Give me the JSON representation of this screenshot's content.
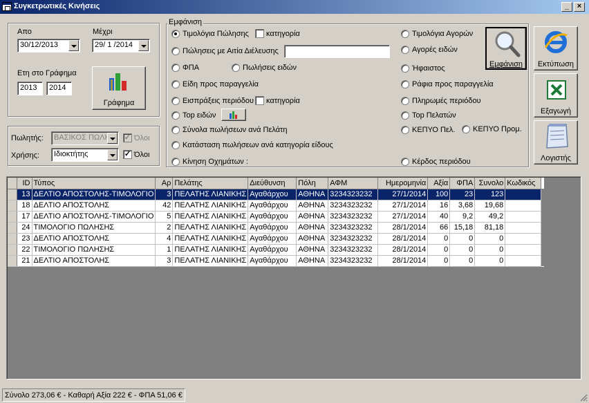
{
  "window": {
    "title": "Συγκετρωτικές Κινήσεις",
    "minimize": "_",
    "close": "×"
  },
  "dates": {
    "from_label": "Απο",
    "to_label": "Μέχρι",
    "from_value": "30/12/2013",
    "to_value": "29/ 1 /2014",
    "years_label": "Ετη στο Γράφημα",
    "year_from": "2013",
    "year_to": "2014",
    "chart_button": "Γράφημα"
  },
  "filters": {
    "seller_label": "Πωλητής:",
    "seller_value": "ΒΑΣΙΚΟΣ ΠΩΛΗ",
    "seller_all": "Όλοι",
    "user_label": "Χρήσης:",
    "user_value": "Ιδιοκτήτης",
    "user_all": "Όλοι"
  },
  "display": {
    "legend": "Εμφάνιση",
    "options": {
      "invoices_sales": "Τιμολόγια Πώλησης",
      "category1": "κατηγορία",
      "sales_by_reason": "Πώλησεις με Αιτία Διέλευσης",
      "vat": "ΦΠΑ",
      "sales_items": "Πωλήσεις ειδών",
      "items_to_order": "Είδη προς παραγγελία",
      "period_receipts": "Εισπράξεις περιόδου",
      "category2": "κατηγορία",
      "top_items": "Top ειδών",
      "sales_per_customer": "Σύνολα πωλήσεων ανά Πελάτη",
      "sales_per_category": "Κατάσταση πωλήσεων ανά κατηγορία είδους",
      "vehicle_moves": "Κίνηση Οχημάτων :",
      "purchase_invoices": "Τιμολόγια Αγορών",
      "item_purchases": "Αγορές ειδών",
      "hephaestus": "Ήφαιστος",
      "shelves_to_order": "Ράφια προς παραγγελία",
      "period_payments": "Πληρωμές περιόδου",
      "top_customers": "Top Πελατών",
      "kepyo_sales": "ΚΕΠΥΟ Πελ.",
      "kepyo_suppliers": "ΚΕΠΥΟ Προμ.",
      "period_profit": "Κέρδος περιόδου"
    },
    "show_button": "Εμφάνιση"
  },
  "side_buttons": {
    "print": "Εκτύπωση",
    "export": "Εξαγωγή",
    "accounting": "Λογιστής"
  },
  "table": {
    "columns": [
      "ID",
      "Τύπος",
      "Αρ",
      "Πελάτης",
      "Διεύθυνση",
      "Πόλη",
      "ΑΦΜ",
      "Ημερομηνία",
      "Αξία",
      "ΦΠΑ",
      "Συνολο",
      "Κωδικός"
    ],
    "rows": [
      [
        "13",
        "ΔΕΛΤΙΟ ΑΠΟΣΤΟΛΗΣ-ΤΙΜΟΛΟΓΙΟ",
        "3",
        "ΠΕΛΑΤΗΣ ΛΙΑΝΙΚΗΣ",
        "Αγαθάρχου",
        "ΑΘΗΝΑ",
        "3234323232",
        "27/1/2014",
        "100",
        "23",
        "123",
        ""
      ],
      [
        "18",
        "ΔΕΛΤΙΟ ΑΠΟΣΤΟΛΗΣ",
        "42",
        "ΠΕΛΑΤΗΣ ΛΙΑΝΙΚΗΣ",
        "Αγαθάρχου",
        "ΑΘΗΝΑ",
        "3234323232",
        "27/1/2014",
        "16",
        "3,68",
        "19,68",
        ""
      ],
      [
        "17",
        "ΔΕΛΤΙΟ ΑΠΟΣΤΟΛΗΣ-ΤΙΜΟΛΟΓΙΟ",
        "5",
        "ΠΕΛΑΤΗΣ ΛΙΑΝΙΚΗΣ",
        "Αγαθάρχου",
        "ΑΘΗΝΑ",
        "3234323232",
        "27/1/2014",
        "40",
        "9,2",
        "49,2",
        ""
      ],
      [
        "24",
        "ΤΙΜΟΛΟΓΙΟ ΠΩΛΗΣΗΣ",
        "2",
        "ΠΕΛΑΤΗΣ ΛΙΑΝΙΚΗΣ",
        "Αγαθάρχου",
        "ΑΘΗΝΑ",
        "3234323232",
        "28/1/2014",
        "66",
        "15,18",
        "81,18",
        ""
      ],
      [
        "23",
        "ΔΕΛΤΙΟ ΑΠΟΣΤΟΛΗΣ",
        "4",
        "ΠΕΛΑΤΗΣ ΛΙΑΝΙΚΗΣ",
        "Αγαθάρχου",
        "ΑΘΗΝΑ",
        "3234323232",
        "28/1/2014",
        "0",
        "0",
        "0",
        ""
      ],
      [
        "22",
        "ΤΙΜΟΛΟΓΙΟ ΠΩΛΗΣΗΣ",
        "1",
        "ΠΕΛΑΤΗΣ ΛΙΑΝΙΚΗΣ",
        "Αγαθάρχου",
        "ΑΘΗΝΑ",
        "3234323232",
        "28/1/2014",
        "0",
        "0",
        "0",
        ""
      ],
      [
        "21",
        "ΔΕΛΤΙΟ ΑΠΟΣΤΟΛΗΣ",
        "3",
        "ΠΕΛΑΤΗΣ ΛΙΑΝΙΚΗΣ",
        "Αγαθάρχου",
        "ΑΘΗΝΑ",
        "3234323232",
        "28/1/2014",
        "0",
        "0",
        "0",
        ""
      ]
    ]
  },
  "status": {
    "summary": "Σύνολο 273,06 € - Καθαρή Αξία 222 € - ΦΠΑ 51,06 €"
  },
  "colors": {
    "selection": "#0a246a",
    "face": "#d4d0c8"
  }
}
